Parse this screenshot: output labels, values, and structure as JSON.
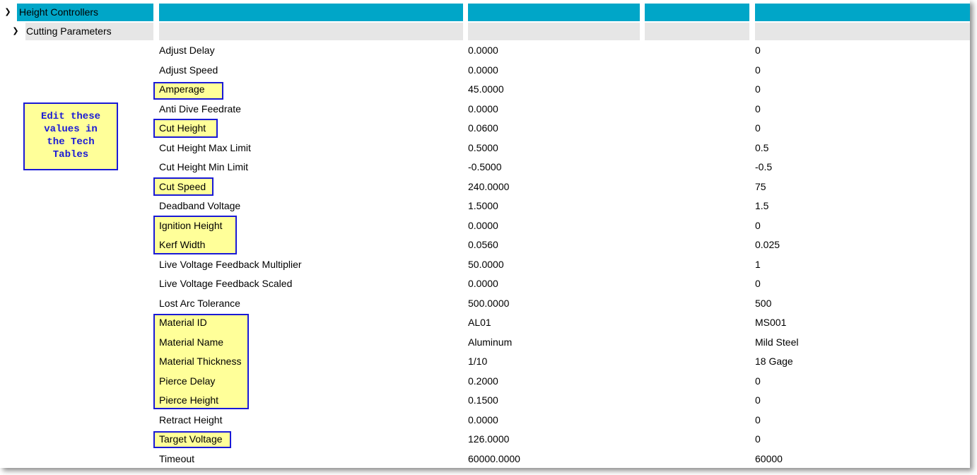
{
  "tree": {
    "root_label": "Height Controllers",
    "child_label": "Cutting Parameters"
  },
  "callout": {
    "text": "Edit these\nvalues in\nthe Tech\nTables"
  },
  "colors": {
    "header": "#00a6c8",
    "subheader": "#e6e6e6",
    "highlight": "#ffff99",
    "box_border": "#1a1ad6"
  },
  "rows": [
    {
      "name": "Adjust Delay",
      "value": "0.0000",
      "default": "0",
      "highlighted": false
    },
    {
      "name": "Adjust Speed",
      "value": "0.0000",
      "default": "0",
      "highlighted": false
    },
    {
      "name": "Amperage",
      "value": "45.0000",
      "default": "0",
      "highlighted": true
    },
    {
      "name": "Anti Dive Feedrate",
      "value": "0.0000",
      "default": "0",
      "highlighted": false
    },
    {
      "name": "Cut Height",
      "value": "0.0600",
      "default": "0",
      "highlighted": true
    },
    {
      "name": "Cut Height Max Limit",
      "value": "0.5000",
      "default": "0.5",
      "highlighted": false
    },
    {
      "name": "Cut Height Min Limit",
      "value": "-0.5000",
      "default": "-0.5",
      "highlighted": false
    },
    {
      "name": "Cut Speed",
      "value": "240.0000",
      "default": "75",
      "highlighted": true
    },
    {
      "name": "Deadband Voltage",
      "value": "1.5000",
      "default": "1.5",
      "highlighted": false
    },
    {
      "name": "Ignition Height",
      "value": "0.0000",
      "default": "0",
      "highlighted": true
    },
    {
      "name": "Kerf Width",
      "value": "0.0560",
      "default": "0.025",
      "highlighted": true
    },
    {
      "name": "Live Voltage Feedback Multiplier",
      "value": "50.0000",
      "default": "1",
      "highlighted": false
    },
    {
      "name": "Live Voltage Feedback Scaled",
      "value": "0.0000",
      "default": "0",
      "highlighted": false
    },
    {
      "name": "Lost Arc Tolerance",
      "value": "500.0000",
      "default": "500",
      "highlighted": false
    },
    {
      "name": "Material ID",
      "value": "AL01",
      "default": "MS001",
      "highlighted": true
    },
    {
      "name": "Material Name",
      "value": "Aluminum",
      "default": "Mild Steel",
      "highlighted": true
    },
    {
      "name": "Material Thickness",
      "value": "1/10",
      "default": "18 Gage",
      "highlighted": true
    },
    {
      "name": "Pierce Delay",
      "value": "0.2000",
      "default": "0",
      "highlighted": true
    },
    {
      "name": "Pierce Height",
      "value": "0.1500",
      "default": "0",
      "highlighted": true
    },
    {
      "name": "Retract Height",
      "value": "0.0000",
      "default": "0",
      "highlighted": false
    },
    {
      "name": "Target Voltage",
      "value": "126.0000",
      "default": "0",
      "highlighted": true
    },
    {
      "name": "Timeout",
      "value": "60000.0000",
      "default": "60000",
      "highlighted": false
    }
  ]
}
